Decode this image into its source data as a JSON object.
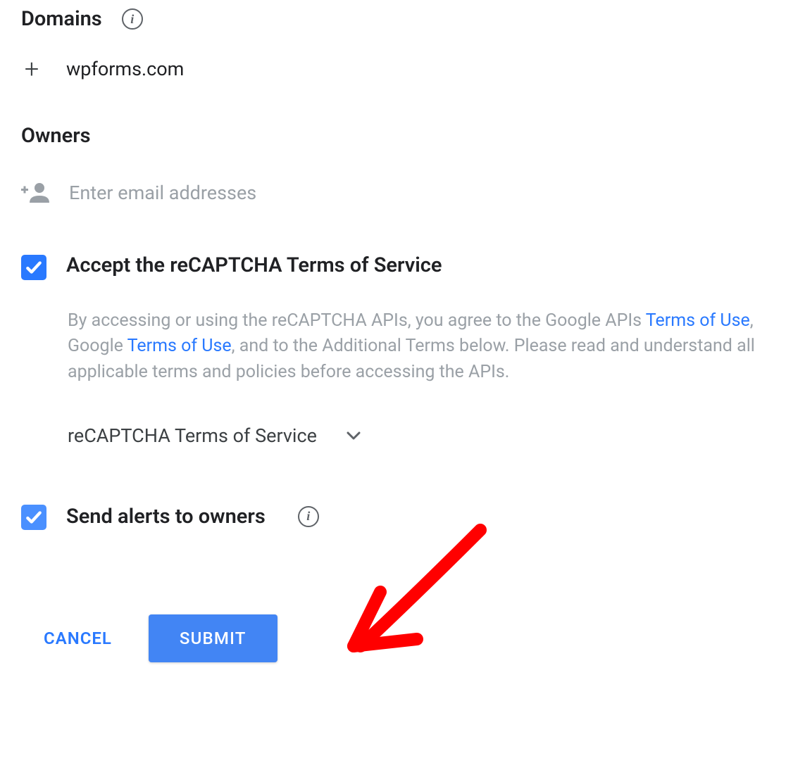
{
  "domains": {
    "title": "Domains",
    "items": [
      "wpforms.com"
    ]
  },
  "owners": {
    "title": "Owners",
    "email_placeholder": "Enter email addresses"
  },
  "tos": {
    "checkbox_label": "Accept the reCAPTCHA Terms of Service",
    "desc_part1": "By accessing or using the reCAPTCHA APIs, you agree to the Google APIs ",
    "link1": "Terms of Use",
    "desc_part2": ", Google ",
    "link2": "Terms of Use",
    "desc_part3": ", and to the Additional Terms below. Please read and understand all applicable terms and policies before accessing the APIs.",
    "dropdown_label": "reCAPTCHA Terms of Service"
  },
  "alerts": {
    "label": "Send alerts to owners"
  },
  "buttons": {
    "cancel": "CANCEL",
    "submit": "SUBMIT"
  }
}
